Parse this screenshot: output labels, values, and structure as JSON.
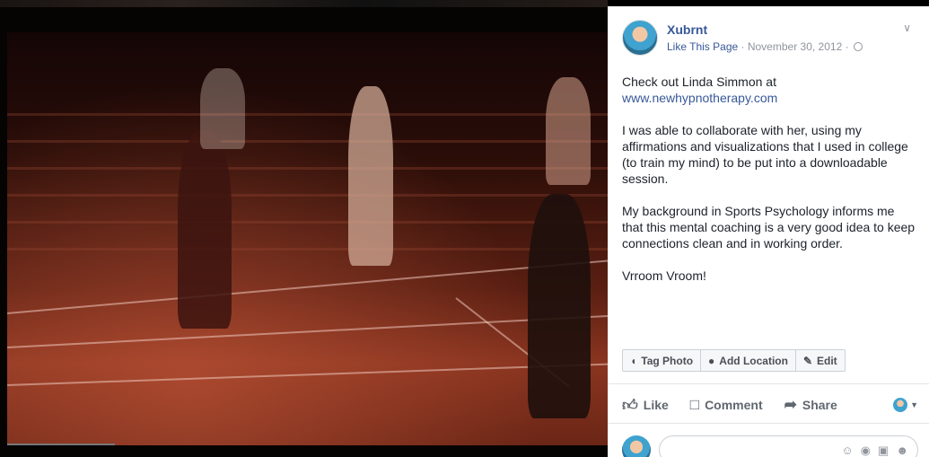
{
  "post": {
    "page_name": "Xubrnt",
    "like_page": "Like This Page",
    "separator": " · ",
    "date": "November 30, 2012",
    "separator2": " · ",
    "paragraphs": {
      "p1_line1": "Check out Linda Simmon at",
      "p1_link": "www.newhypnotherapy.com",
      "p2": "I was able to collaborate with her, using my affirmations and visualizations that I used in college (to train my mind) to be put into a downloadable session.",
      "p3": "My background in Sports Psychology informs me that this mental coaching is a very good idea to keep connections clean and in working order.",
      "p4": "Vrroom Vroom!"
    }
  },
  "tools": {
    "tag_photo": "Tag Photo",
    "add_location": "Add Location",
    "edit": "Edit"
  },
  "actions": {
    "like": "Like",
    "comment": "Comment",
    "share": "Share"
  },
  "icons": {
    "tag": "tag-icon",
    "pin": "location-pin-icon",
    "pencil": "pencil-icon",
    "like": "thumbs-up-icon",
    "comment": "speech-bubble-icon",
    "share": "share-arrow-icon",
    "globe": "globe-icon",
    "chevron": "chevron-down-icon"
  }
}
